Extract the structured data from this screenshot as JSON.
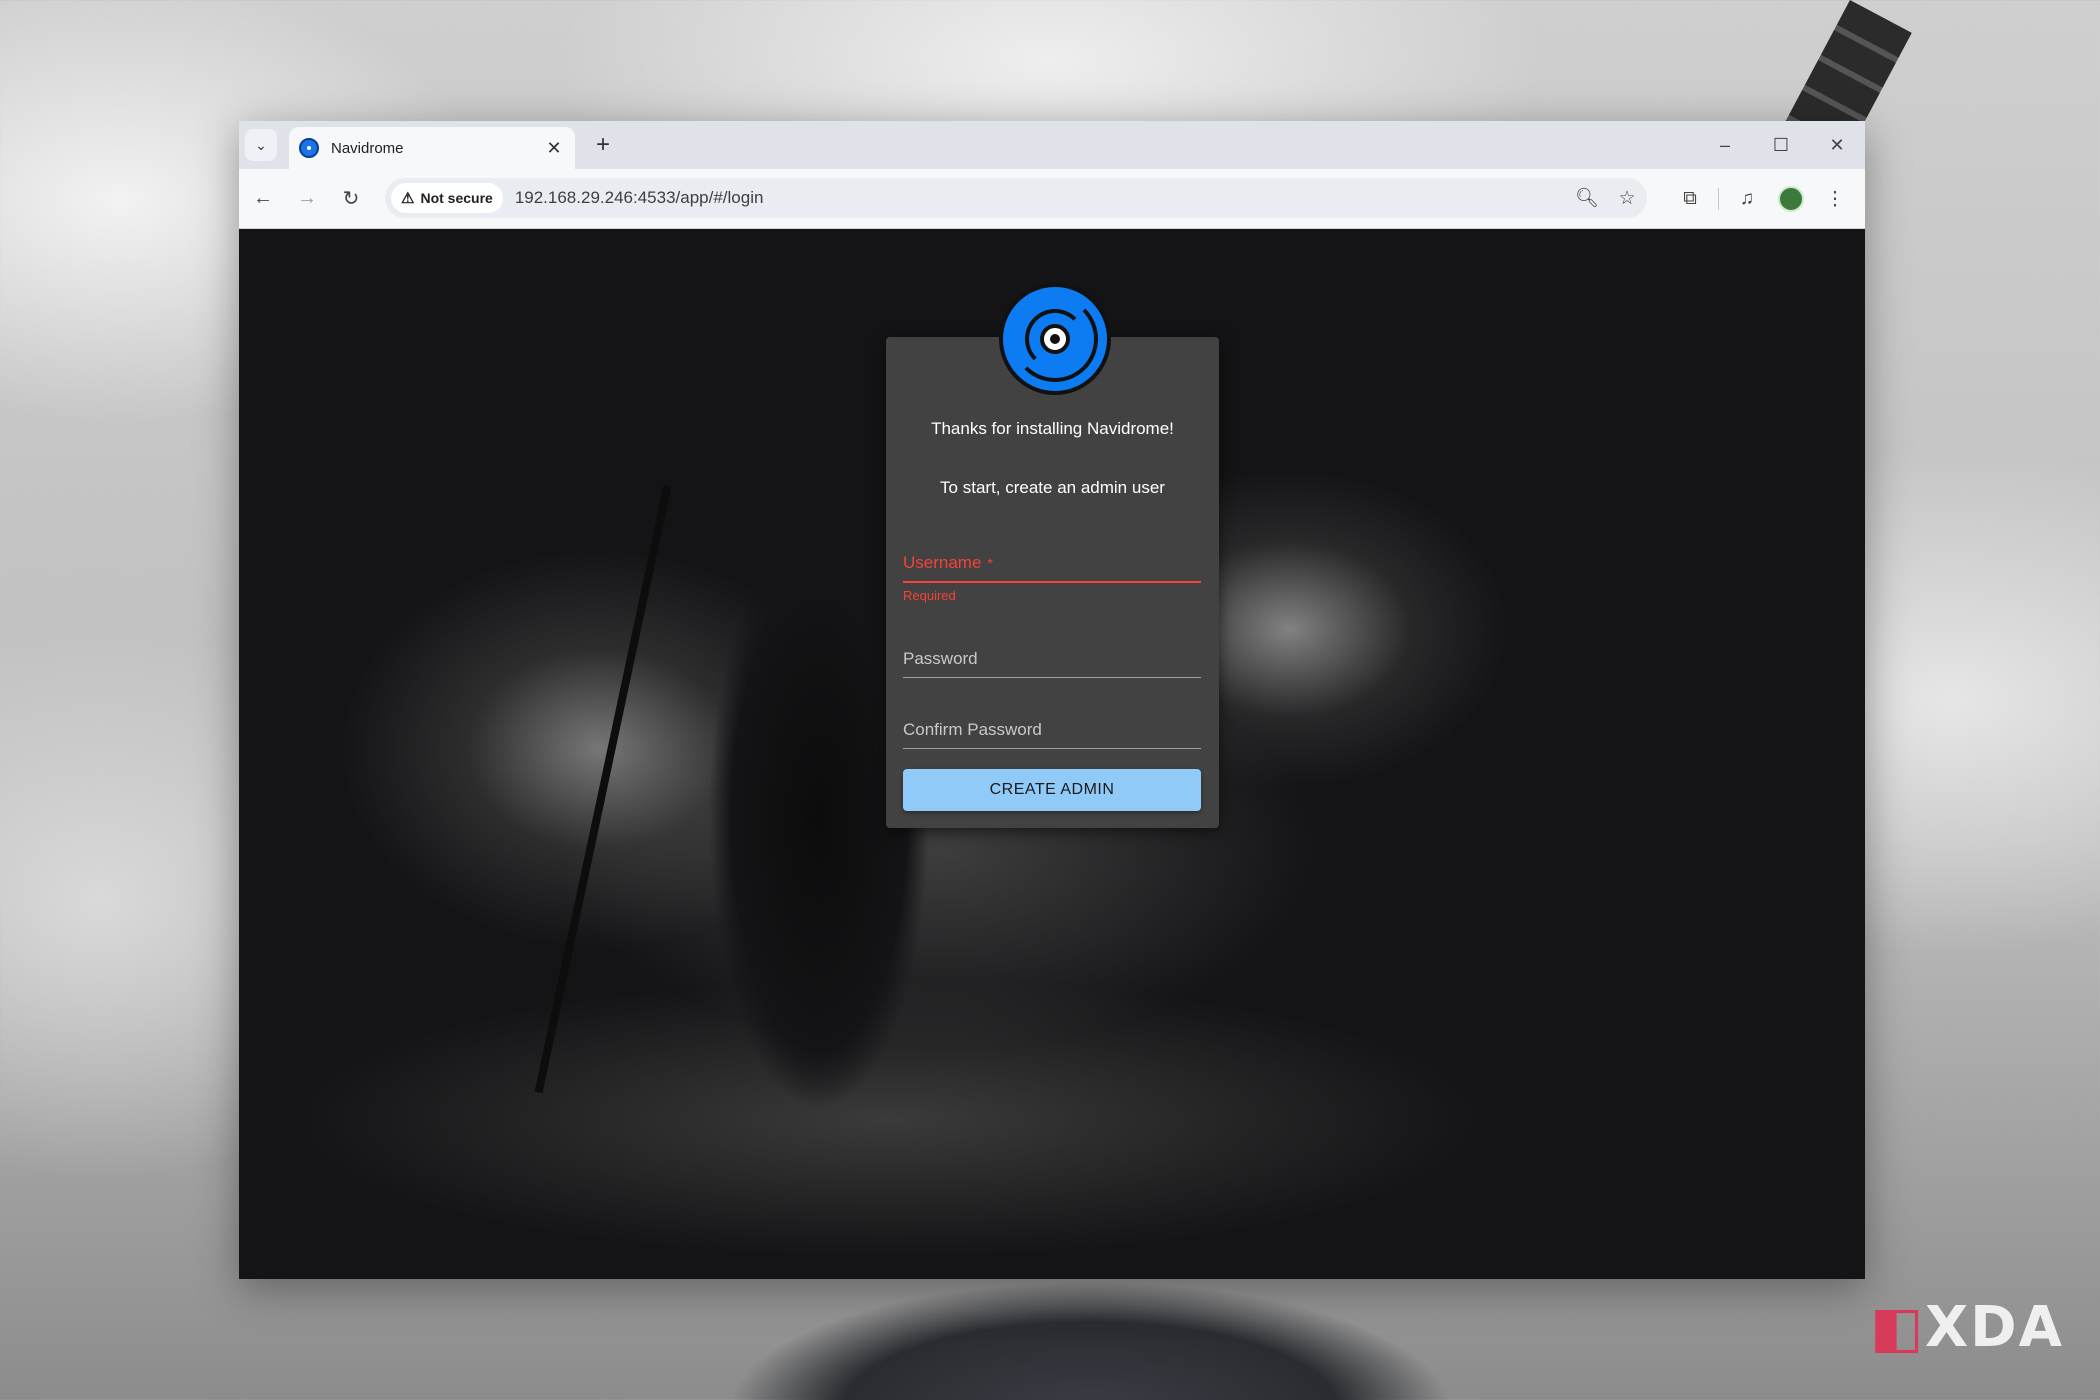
{
  "browser": {
    "tab": {
      "title": "Navidrome"
    },
    "new_tab_glyph": "+",
    "tab_list_glyph": "⌄",
    "window_controls": {
      "minimize": "–",
      "maximize": "☐",
      "close": "✕"
    },
    "toolbar": {
      "security_label": "Not secure",
      "url": "192.168.29.246:4533/app/#/login"
    }
  },
  "page": {
    "welcome_text": "Thanks for installing Navidrome!",
    "instruction_text": "To start, create an admin user",
    "form": {
      "username_label": "Username",
      "username_required_marker": "*",
      "username_error": "Required",
      "password_label": "Password",
      "confirm_password_label": "Confirm Password",
      "submit_label": "CREATE ADMIN"
    }
  },
  "watermark": {
    "mark": "◧",
    "text": "XDA"
  },
  "colors": {
    "accent": "#90caf9",
    "logo_blue": "#0d7bf2",
    "error": "#f44336",
    "card": "#424242"
  },
  "icons": [
    "tab-list-icon",
    "navidrome-favicon-icon",
    "close-tab-icon",
    "new-tab-icon",
    "back-arrow-icon",
    "forward-arrow-icon",
    "reload-icon",
    "warning-icon",
    "zoom-icon",
    "star-icon",
    "extensions-icon",
    "media-controls-icon",
    "profile-icon",
    "kebab-menu-icon",
    "navidrome-logo-icon"
  ]
}
